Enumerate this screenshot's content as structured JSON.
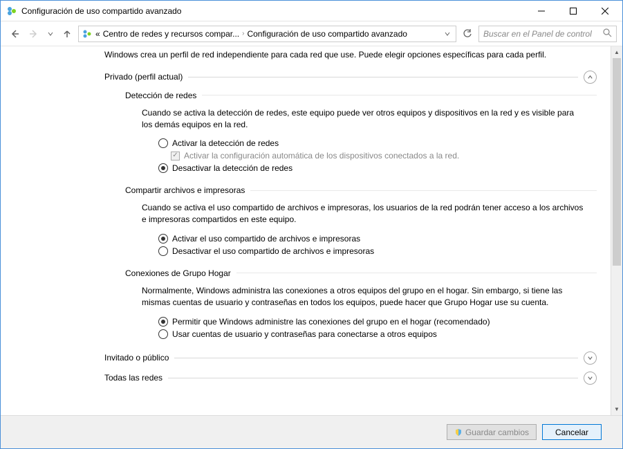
{
  "window": {
    "title": "Configuración de uso compartido avanzado"
  },
  "breadcrumb": {
    "item1": "Centro de redes y recursos compar...",
    "item2": "Configuración de uso compartido avanzado"
  },
  "search": {
    "placeholder": "Buscar en el Panel de control"
  },
  "intro": "Windows crea un perfil de red independiente para cada red que use. Puede elegir opciones específicas para cada perfil.",
  "sections": {
    "private": {
      "label": "Privado (perfil actual)",
      "detection": {
        "title": "Detección de redes",
        "desc": "Cuando se activa la detección de redes, este equipo puede ver otros equipos y dispositivos en la red y es visible para los demás equipos en la red.",
        "opt_on": "Activar la detección de redes",
        "auto_config": "Activar la configuración automática de los dispositivos conectados a la red.",
        "opt_off": "Desactivar la detección de redes"
      },
      "sharing": {
        "title": "Compartir archivos e impresoras",
        "desc": "Cuando se activa el uso compartido de archivos e impresoras, los usuarios de la red podrán tener acceso a los archivos e impresoras compartidos en este equipo.",
        "opt_on": "Activar el uso compartido de archivos e impresoras",
        "opt_off": "Desactivar el uso compartido de archivos e impresoras"
      },
      "homegroup": {
        "title": "Conexiones de Grupo Hogar",
        "desc": "Normalmente, Windows administra las conexiones a otros equipos del grupo en el hogar. Sin embargo, si tiene las mismas cuentas de usuario y contraseñas en todos los equipos, puede hacer que Grupo Hogar use su cuenta.",
        "opt_windows": "Permitir que Windows administre las conexiones del grupo en el hogar (recomendado)",
        "opt_user": "Usar cuentas de usuario y contraseñas para conectarse a otros equipos"
      }
    },
    "guest": {
      "label": "Invitado o público"
    },
    "all": {
      "label": "Todas las redes"
    }
  },
  "footer": {
    "save": "Guardar cambios",
    "cancel": "Cancelar"
  }
}
